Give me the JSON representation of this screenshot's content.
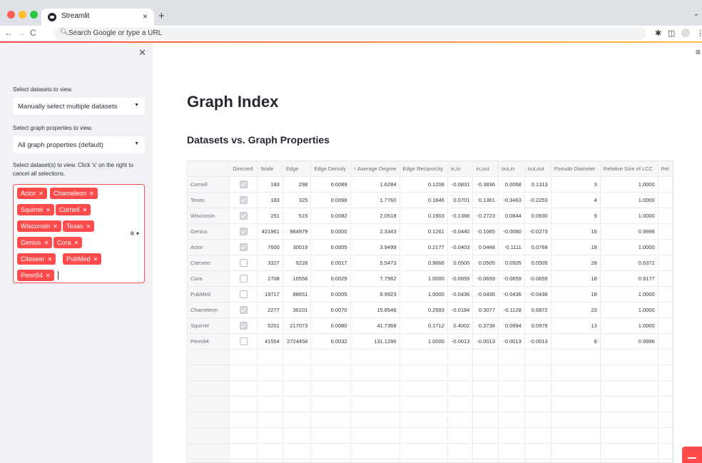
{
  "browser": {
    "tab_title": "Streamlit",
    "tab_close": "×",
    "new_tab": "+",
    "address_placeholder": "Search Google or type a URL"
  },
  "sidebar": {
    "datasets_label": "Select datasets to view.",
    "datasets_value": "Manually select multiple datasets",
    "properties_label": "Select graph properties to view.",
    "properties_value": "All graph properties (default)",
    "multiselect_label_1": "Select dataset(s) to view. Click 'x' on the right to",
    "multiselect_label_2": "cancel all selections.",
    "chips": [
      "Actor",
      "Chameleon",
      "Squirrel",
      "Cornell",
      "Wisconsin",
      "Texas",
      "Genius",
      "Cora",
      "Citeseer",
      "PubMed",
      "Penn94"
    ]
  },
  "main": {
    "title": "Graph Index",
    "subtitle": "Datasets vs. Graph Properties"
  },
  "table": {
    "columns": [
      "Directed",
      "Node",
      "Edge",
      "Edge Density",
      "↑ Average Degree",
      "Edge Reciprocity",
      "in,in",
      "in,out",
      "out,in",
      "out,out",
      "Pseudo Diameter",
      "Relative Size of LCC",
      "Rel"
    ],
    "rows": [
      {
        "name": "Cornell",
        "directed": true,
        "cells": [
          "183",
          "298",
          "0.0089",
          "1.6284",
          "0.1208",
          "-0.0831",
          "-0.3836",
          "0.0068",
          "0.1313",
          "3",
          "1.0000"
        ]
      },
      {
        "name": "Texas",
        "directed": true,
        "cells": [
          "183",
          "325",
          "0.0098",
          "1.7760",
          "0.1846",
          "0.0701",
          "0.1361",
          "-0.3463",
          "-0.2253",
          "4",
          "1.0000"
        ]
      },
      {
        "name": "Wisconsin",
        "directed": true,
        "cells": [
          "251",
          "515",
          "0.0082",
          "2.0518",
          "0.1903",
          "-0.1388",
          "-0.2723",
          "0.0844",
          "0.0930",
          "9",
          "1.0000"
        ]
      },
      {
        "name": "Genius",
        "directed": true,
        "cells": [
          "421961",
          "984979",
          "0.0000",
          "2.3343",
          "0.1261",
          "-0.0440",
          "-0.1065",
          "-0.0080",
          "-0.0273",
          "16",
          "0.9998"
        ]
      },
      {
        "name": "Actor",
        "directed": true,
        "cells": [
          "7600",
          "30019",
          "0.0005",
          "3.9499",
          "0.2177",
          "-0.0403",
          "0.0448",
          "-0.1111",
          "0.0768",
          "18",
          "1.0000"
        ]
      },
      {
        "name": "Citeseer",
        "directed": false,
        "cells": [
          "3327",
          "9228",
          "0.0017",
          "5.5473",
          "0.9866",
          "0.0505",
          "0.0505",
          "0.0505",
          "0.0505",
          "28",
          "0.6372"
        ]
      },
      {
        "name": "Cora",
        "directed": false,
        "cells": [
          "2708",
          "10556",
          "0.0029",
          "7.7962",
          "1.0000",
          "-0.0659",
          "-0.0659",
          "-0.0659",
          "-0.0659",
          "18",
          "0.9177"
        ]
      },
      {
        "name": "PubMed",
        "directed": false,
        "cells": [
          "19717",
          "88651",
          "0.0005",
          "8.9923",
          "1.0000",
          "-0.0436",
          "-0.0436",
          "-0.0436",
          "-0.0436",
          "18",
          "1.0000"
        ]
      },
      {
        "name": "Chameleon",
        "directed": true,
        "cells": [
          "2277",
          "36101",
          "0.0070",
          "15.8546",
          "0.2593",
          "-0.0184",
          "0.3077",
          "-0.1128",
          "0.6872",
          "23",
          "1.0000"
        ]
      },
      {
        "name": "Squirrel",
        "directed": true,
        "cells": [
          "5201",
          "217073",
          "0.0080",
          "41.7368",
          "0.1712",
          "0.4002",
          "0.3738",
          "0.0994",
          "0.0976",
          "13",
          "1.0000"
        ]
      },
      {
        "name": "Penn94",
        "directed": false,
        "cells": [
          "41554",
          "2724458",
          "0.0032",
          "131.1286",
          "1.0000",
          "-0.0013",
          "-0.0013",
          "-0.0013",
          "-0.0013",
          "8",
          "0.9996"
        ]
      }
    ],
    "empty_rows": 8
  }
}
